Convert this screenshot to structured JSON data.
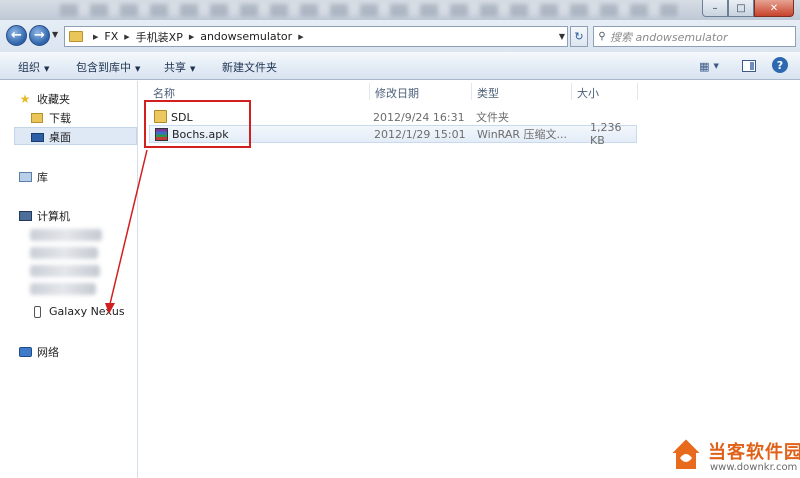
{
  "window": {
    "minimize_glyph": "–",
    "maximize_glyph": "□",
    "close_glyph": "✕"
  },
  "address": {
    "back_glyph": "←",
    "forward_glyph": "→",
    "breadcrumb": [
      "FX",
      "手机装XP",
      "andowsemulator"
    ],
    "refresh_glyph": "↻",
    "search_placeholder": "搜索 andowsemulator"
  },
  "toolbar": {
    "organize": "组织",
    "include_library": "包含到库中",
    "share": "共享",
    "new_folder": "新建文件夹",
    "help": "?"
  },
  "navpane": {
    "favorites": "收藏夹",
    "downloads": "下载",
    "desktop": "桌面",
    "libraries": "库",
    "computer": "计算机",
    "device": "Galaxy Nexus",
    "network": "网络"
  },
  "columns": {
    "name": "名称",
    "modified": "修改日期",
    "type": "类型",
    "size": "大小"
  },
  "files": [
    {
      "name": "SDL",
      "modified": "2012/9/24 16:31",
      "type": "文件夹",
      "size": "",
      "icon": "folder-icon"
    },
    {
      "name": "Bochs.apk",
      "modified": "2012/1/29 15:01",
      "type": "WinRAR 压缩文...",
      "size": "1,236 KB",
      "icon": "winrar-icon"
    }
  ],
  "watermark": {
    "title": "当客软件园",
    "url": "www.downkr.com"
  },
  "colors": {
    "annotation_red": "#d21f1f",
    "watermark_orange": "#e0621a"
  }
}
